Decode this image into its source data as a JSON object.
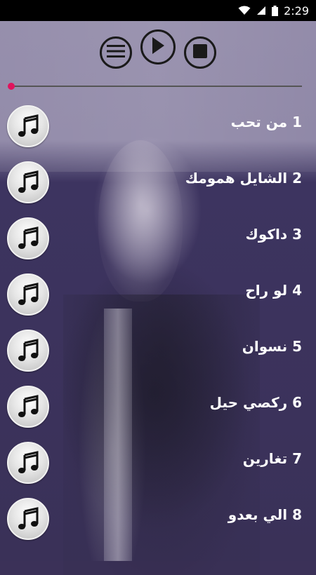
{
  "status_bar": {
    "time": "2:29",
    "icons": [
      "wifi-icon",
      "signal-icon",
      "battery-icon"
    ]
  },
  "player": {
    "controls": [
      "menu-icon",
      "play-icon",
      "stop-icon"
    ],
    "progress": 0,
    "accent_color": "#e0135d"
  },
  "songs": [
    {
      "label": "1 من تحب"
    },
    {
      "label": "2 الشايل همومك"
    },
    {
      "label": "3 داكوك"
    },
    {
      "label": "4  لو راح"
    },
    {
      "label": "5  نسوان"
    },
    {
      "label": "6 ركصي حيل"
    },
    {
      "label": "7 تغارين"
    },
    {
      "label": "8 الي بعدو"
    }
  ]
}
